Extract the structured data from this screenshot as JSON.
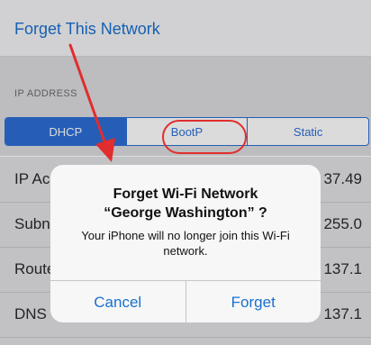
{
  "forget_link": "Forget This Network",
  "section_header": "IP ADDRESS",
  "segments": [
    "DHCP",
    "BootP",
    "Static"
  ],
  "rows": [
    {
      "label": "IP Ac",
      "value": "37.49"
    },
    {
      "label": "Subn",
      "value": "255.0"
    },
    {
      "label": "Route",
      "value": "137.1"
    },
    {
      "label": "DNS",
      "value": "137.1"
    }
  ],
  "alert": {
    "title_line1": "Forget Wi-Fi Network",
    "title_line2": "“George Washington” ?",
    "message": "Your iPhone will no longer join this Wi-Fi network.",
    "cancel_label": "Cancel",
    "forget_label": "Forget"
  },
  "colors": {
    "accent": "#1a70d0",
    "annotation": "#e12d2d"
  }
}
